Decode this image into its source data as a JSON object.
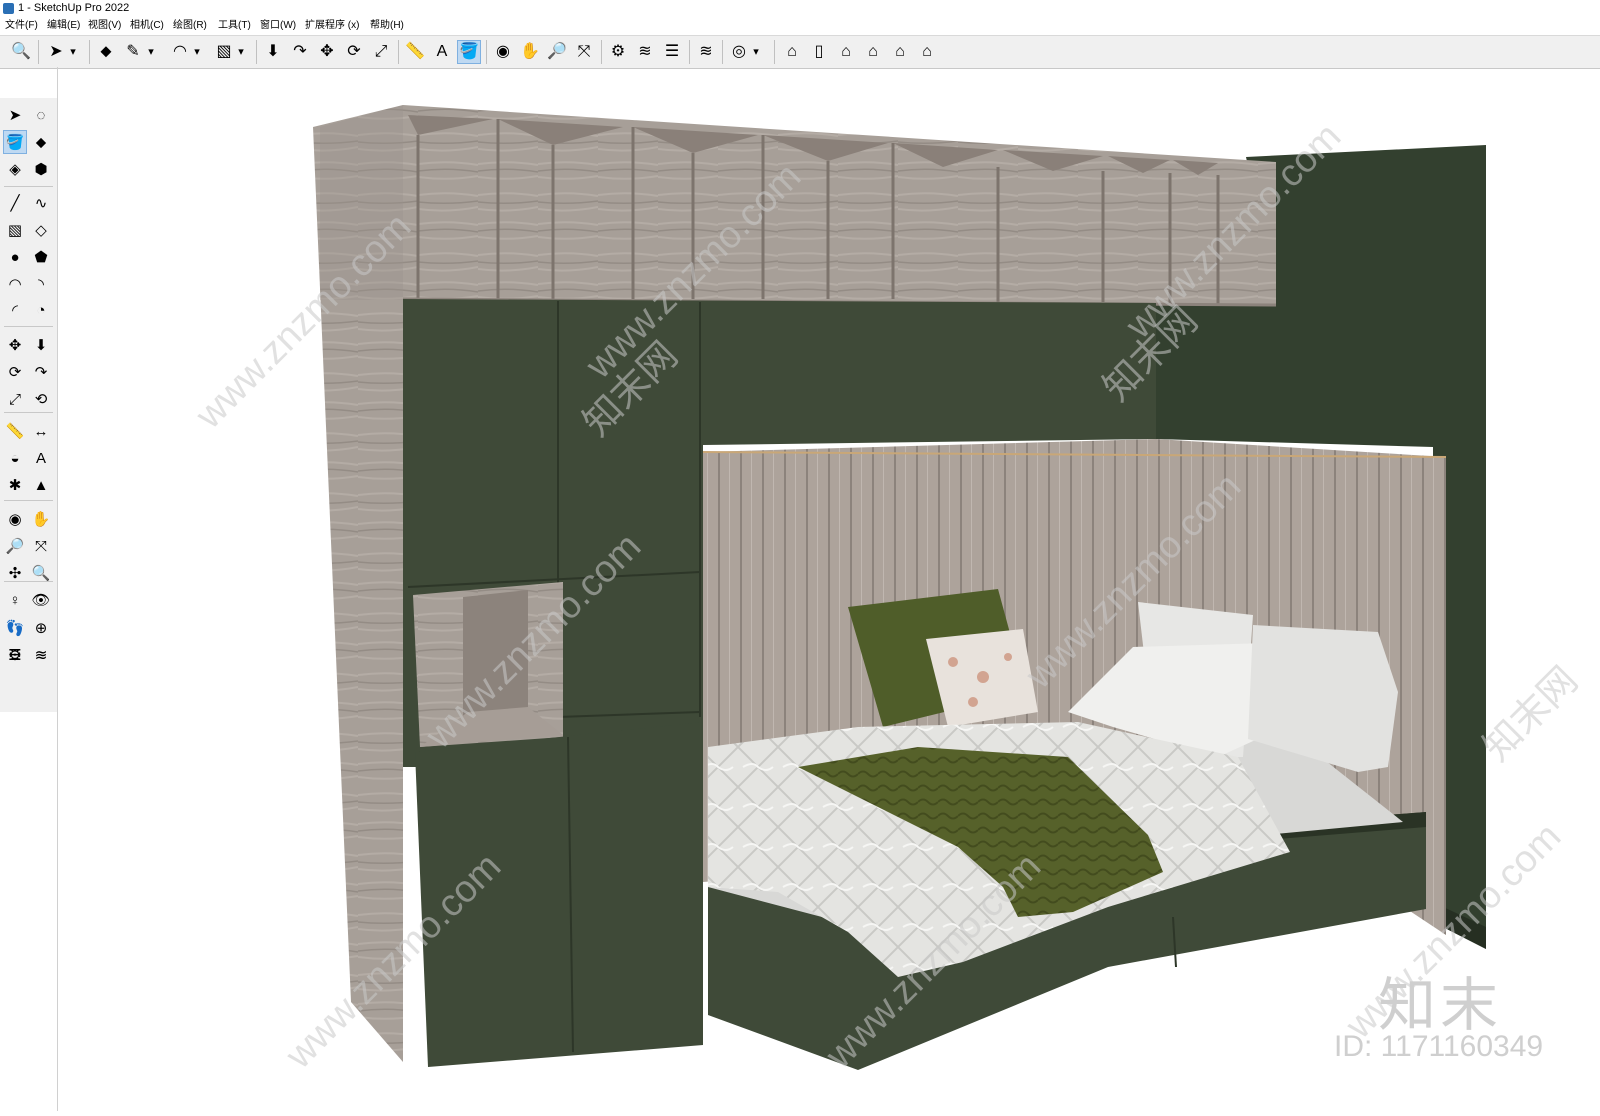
{
  "window": {
    "title": "1 - SketchUp Pro 2022"
  },
  "menu": [
    "文件(F)",
    "编辑(E)",
    "视图(V)",
    "相机(C)",
    "绘图(R)",
    "工具(T)",
    "窗口(W)",
    "扩展程序 (x)",
    "帮助(H)"
  ],
  "toolbar": [
    {
      "name": "zoom-extents-icon",
      "glyph": "🔍"
    },
    {
      "name": "select-icon",
      "glyph": "➤"
    },
    {
      "name": "select-dropdown-icon",
      "glyph": "▾"
    },
    {
      "name": "eraser-icon",
      "glyph": "⬥"
    },
    {
      "name": "pencil-icon",
      "glyph": "✎"
    },
    {
      "name": "pencil-dropdown-icon",
      "glyph": "▾"
    },
    {
      "name": "arc-icon",
      "glyph": "◠"
    },
    {
      "name": "arc-dropdown-icon",
      "glyph": "▾"
    },
    {
      "name": "rectangle-icon",
      "glyph": "▧"
    },
    {
      "name": "rectangle-dropdown-icon",
      "glyph": "▾"
    },
    {
      "name": "push-pull-icon",
      "glyph": "⬇"
    },
    {
      "name": "follow-me-icon",
      "glyph": "↷"
    },
    {
      "name": "move-icon",
      "glyph": "✥"
    },
    {
      "name": "rotate-icon",
      "glyph": "⟳"
    },
    {
      "name": "scale-icon",
      "glyph": "⤢"
    },
    {
      "name": "tape-measure-icon",
      "glyph": "📏"
    },
    {
      "name": "text-icon",
      "glyph": "A"
    },
    {
      "name": "paint-bucket-icon",
      "glyph": "🪣"
    },
    {
      "name": "orbit-icon",
      "glyph": "◉"
    },
    {
      "name": "pan-icon",
      "glyph": "✋"
    },
    {
      "name": "zoom-icon",
      "glyph": "🔎"
    },
    {
      "name": "zoom-window-icon",
      "glyph": "⤧"
    },
    {
      "name": "warehouse-icon",
      "glyph": "⚙"
    },
    {
      "name": "extension-warehouse-icon",
      "glyph": "≋"
    },
    {
      "name": "layers-icon",
      "glyph": "☰"
    },
    {
      "name": "send-to-layout-icon",
      "glyph": "≋"
    },
    {
      "name": "profile-icon",
      "glyph": "◎"
    },
    {
      "name": "profile-dropdown-icon",
      "glyph": "▾"
    },
    {
      "name": "iso-view-icon",
      "glyph": "⌂"
    },
    {
      "name": "right-view-icon",
      "glyph": "▯"
    },
    {
      "name": "front-view-icon",
      "glyph": "⌂"
    },
    {
      "name": "top-view-icon",
      "glyph": "⌂"
    },
    {
      "name": "back-view-icon",
      "glyph": "⌂"
    },
    {
      "name": "left-view-icon",
      "glyph": "⌂"
    }
  ],
  "left_tools": [
    {
      "name": "select-tool-icon",
      "glyph": "➤"
    },
    {
      "name": "orbit-small-icon",
      "glyph": "◌"
    },
    {
      "name": "paint-tool-icon",
      "glyph": "🪣"
    },
    {
      "name": "eraser-tool-icon",
      "glyph": "⬥"
    },
    {
      "name": "component-tool-icon",
      "glyph": "◈"
    },
    {
      "name": "tag-tool-icon",
      "glyph": "⬢"
    },
    {
      "name": "line-tool-icon",
      "glyph": "╱"
    },
    {
      "name": "freehand-tool-icon",
      "glyph": "∿"
    },
    {
      "name": "rectangle-tool-icon",
      "glyph": "▧"
    },
    {
      "name": "rotated-rectangle-tool-icon",
      "glyph": "◇"
    },
    {
      "name": "circle-tool-icon",
      "glyph": "●"
    },
    {
      "name": "polygon-tool-icon",
      "glyph": "⬟"
    },
    {
      "name": "arc-tool-icon",
      "glyph": "◠"
    },
    {
      "name": "two-point-arc-tool-icon",
      "glyph": "◝"
    },
    {
      "name": "three-point-arc-tool-icon",
      "glyph": "◜"
    },
    {
      "name": "pie-tool-icon",
      "glyph": "◔"
    },
    {
      "name": "move-tool-icon",
      "glyph": "✥"
    },
    {
      "name": "push-pull-tool-icon",
      "glyph": "⬇"
    },
    {
      "name": "rotate-tool-icon",
      "glyph": "⟳"
    },
    {
      "name": "follow-me-tool-icon",
      "glyph": "↷"
    },
    {
      "name": "scale-tool-icon",
      "glyph": "⤢"
    },
    {
      "name": "offset-tool-icon",
      "glyph": "⟲"
    },
    {
      "name": "tape-tool-icon",
      "glyph": "📏"
    },
    {
      "name": "dimension-tool-icon",
      "glyph": "↔"
    },
    {
      "name": "protractor-tool-icon",
      "glyph": "◒"
    },
    {
      "name": "text-tool-icon",
      "glyph": "A"
    },
    {
      "name": "axes-tool-icon",
      "glyph": "✱"
    },
    {
      "name": "3d-text-tool-icon",
      "glyph": "▲"
    },
    {
      "name": "orbit-tool-icon",
      "glyph": "◉"
    },
    {
      "name": "pan-tool-icon",
      "glyph": "✋"
    },
    {
      "name": "zoom-tool-icon",
      "glyph": "🔎"
    },
    {
      "name": "zoom-window-tool-icon",
      "glyph": "⤧"
    },
    {
      "name": "zoom-extents-tool-icon",
      "glyph": "✣"
    },
    {
      "name": "previous-view-tool-icon",
      "glyph": "🔍"
    },
    {
      "name": "position-camera-tool-icon",
      "glyph": "♀"
    },
    {
      "name": "look-around-tool-icon",
      "glyph": "👁"
    },
    {
      "name": "walk-tool-icon",
      "glyph": "👣"
    },
    {
      "name": "section-plane-tool-icon",
      "glyph": "⊕"
    },
    {
      "name": "warehouse-tool-icon",
      "glyph": "⚙"
    },
    {
      "name": "extension-tool-icon",
      "glyph": "≋"
    },
    {
      "name": "layers-tool-icon",
      "glyph": "☰"
    },
    {
      "name": "layout-tool-icon",
      "glyph": "≋"
    }
  ],
  "colors": {
    "cabinet_green": "#3f4a38",
    "wood": "#a79f98",
    "wood_dark": "#8e857e",
    "bed_white": "#e6e6e3",
    "throw_green": "#56612a",
    "wall_green": "#33402f"
  },
  "watermark": {
    "site": "www.znzmo.com",
    "brand": "知末",
    "brand_net": "知末网",
    "image_id": "ID: 1171160349"
  }
}
